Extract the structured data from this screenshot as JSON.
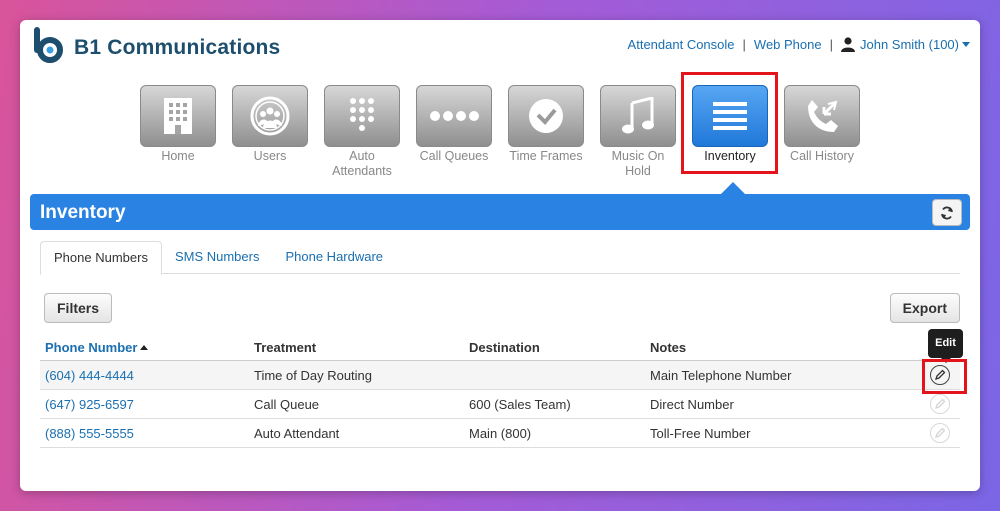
{
  "app": {
    "brand": "B1 Communications"
  },
  "header": {
    "links": [
      "Attendant Console",
      "Web Phone"
    ],
    "separator": "|",
    "user": "John Smith (100)"
  },
  "nav": [
    {
      "label": "Home",
      "icon": "building-icon"
    },
    {
      "label": "Users",
      "icon": "users-icon"
    },
    {
      "label": "Auto Attendants",
      "icon": "keypad-icon"
    },
    {
      "label": "Call Queues",
      "icon": "dots-icon"
    },
    {
      "label": "Time Frames",
      "icon": "clock-icon"
    },
    {
      "label": "Music On Hold",
      "icon": "music-note-icon"
    },
    {
      "label": "Inventory",
      "icon": "list-icon",
      "active": true
    },
    {
      "label": "Call History",
      "icon": "call-history-icon"
    }
  ],
  "page": {
    "title": "Inventory"
  },
  "tabs": [
    {
      "label": "Phone Numbers",
      "active": true
    },
    {
      "label": "SMS Numbers"
    },
    {
      "label": "Phone Hardware"
    }
  ],
  "toolbar": {
    "filters": "Filters",
    "export": "Export"
  },
  "table": {
    "columns": [
      "Phone Number",
      "Treatment",
      "Destination",
      "Notes"
    ],
    "rows": [
      {
        "phone": "(604) 444-4444",
        "treatment": "Time of Day Routing",
        "destination": "",
        "notes": "Main Telephone Number"
      },
      {
        "phone": "(647) 925-6597",
        "treatment": "Call Queue",
        "destination": "600 (Sales Team)",
        "notes": "Direct Number"
      },
      {
        "phone": "(888) 555-5555",
        "treatment": "Auto Attendant",
        "destination": "Main (800)",
        "notes": "Toll-Free Number"
      }
    ]
  },
  "tooltip": {
    "text": "Edit"
  },
  "colors": {
    "accent": "#2a83e2",
    "link": "#1a6fb0",
    "highlight": "#e3141c",
    "brand": "#1d4e6e"
  }
}
